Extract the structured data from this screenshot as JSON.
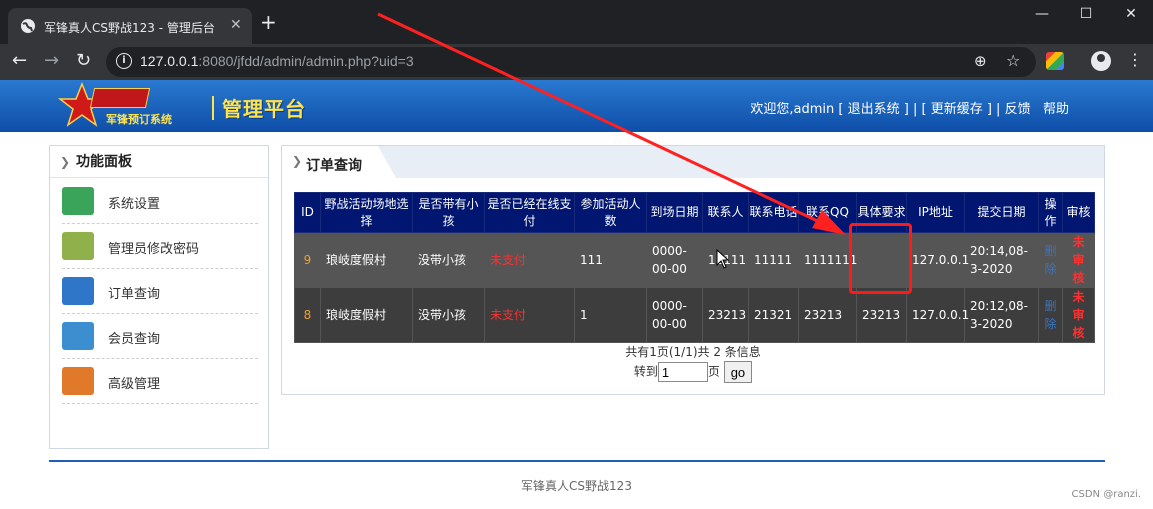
{
  "browser": {
    "tab_title": "军锋真人CS野战123 - 管理后台",
    "tab_close": "✕",
    "new_tab": "+",
    "url_host": "127.0.0.1",
    "url_rest": ":8080/jfdd/admin/admin.php?uid=3",
    "window_controls": [
      "—",
      "☐",
      "✕"
    ]
  },
  "header": {
    "logo_text": "军锋预订系统",
    "platform_title": "管理平台",
    "welcome": "欢迎您,admin",
    "links": [
      "[ 退出系统 ]",
      "| [ 更新缓存 ] |",
      "反馈",
      "帮助"
    ]
  },
  "sidebar": {
    "title": "功能面板",
    "items": [
      {
        "label": "系统设置",
        "icon": "settings-icon",
        "color": "#3aa55a"
      },
      {
        "label": "管理员修改密码",
        "icon": "password-icon",
        "color": "#8fb04a"
      },
      {
        "label": "订单查询",
        "icon": "order-icon",
        "color": "#2f76c8"
      },
      {
        "label": "会员查询",
        "icon": "member-icon",
        "color": "#3b8fd0"
      },
      {
        "label": "高级管理",
        "icon": "users-icon",
        "color": "#e07a2a"
      }
    ]
  },
  "panel": {
    "title": "订单查询",
    "columns": [
      "ID",
      "野战活动场地选择",
      "是否带有小孩",
      "是否已经在线支付",
      "参加活动人数",
      "到场日期",
      "联系人",
      "联系电话",
      "联系QQ",
      "具体要求",
      "IP地址",
      "提交日期",
      "操作",
      "审核"
    ],
    "rows": [
      {
        "id": "9",
        "site": "琅岐度假村",
        "child": "没带小孩",
        "paid": "未支付",
        "people": "111",
        "date": "0000-00-00",
        "contact": "11111",
        "phone": "11111",
        "qq": "1111111",
        "req": "",
        "ip": "127.0.0.1",
        "submit": "20:14,08-3-2020",
        "op": "删除",
        "audit": "未审核"
      },
      {
        "id": "8",
        "site": "琅岐度假村",
        "child": "没带小孩",
        "paid": "未支付",
        "people": "1",
        "date": "0000-00-00",
        "contact": "23213",
        "phone": "21321",
        "qq": "23213",
        "req": "23213",
        "ip": "127.0.0.1",
        "submit": "20:12,08-3-2020",
        "op": "删除",
        "audit": "未审核"
      }
    ],
    "pager_info": "共有1页(1/1)共 2  条信息",
    "goto_label": "转到",
    "goto_value": "1",
    "page_suffix": "页",
    "go_label": "go"
  },
  "footer": {
    "text": "军锋真人CS野战123",
    "watermark": "CSDN @ranzi."
  }
}
